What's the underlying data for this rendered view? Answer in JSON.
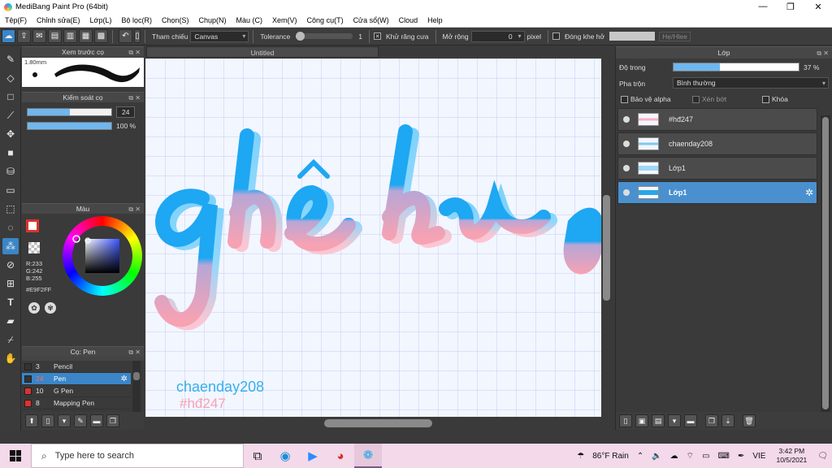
{
  "window": {
    "title": "MediBang Paint Pro (64bit)",
    "controls": [
      "—",
      "❐",
      "✕"
    ]
  },
  "menu": [
    "Tệp(F)",
    "Chỉnh sửa(E)",
    "Lớp(L)",
    "Bộ lọc(R)",
    "Chọn(S)",
    "Chụp(N)",
    "Màu (C)",
    "Xem(V)",
    "Công cụ(T)",
    "Cửa sổ(W)",
    "Cloud",
    "Help"
  ],
  "toolbar": {
    "reference_label": "Tham chiếu",
    "reference_value": "Canvas",
    "tolerance_label": "Tolerance",
    "tolerance_value": "1",
    "antialias_label": "Khử răng cưa",
    "expand_label": "Mở rộng",
    "expand_value": "0",
    "expand_unit": "pixel",
    "close_gap_label": "Đóng khe hở",
    "disabled_label": "Hẹ/Hlee"
  },
  "panels": {
    "brush_preview": {
      "title": "Xem trước cọ",
      "size_label": "1.80mm"
    },
    "brush_control": {
      "title": "Kiểm soát cọ",
      "size_value": "24",
      "size_fraction": 0.5,
      "opacity_value": "100 %",
      "opacity_fraction": 1.0
    },
    "color": {
      "title": "Màu",
      "r": "R:233",
      "g": "G:242",
      "b": "B:255",
      "hex": "#E9F2FF",
      "fg_color": "#e8e8e8",
      "accent": "#d9342b"
    },
    "brush_list": {
      "title": "Cọ: Pen",
      "items": [
        {
          "num": "3",
          "name": "Pencil",
          "color": "#333333"
        },
        {
          "num": "24",
          "name": "Pen",
          "color": "#333333",
          "selected": true
        },
        {
          "num": "10",
          "name": "G Pen",
          "color": "#e03030"
        },
        {
          "num": "8",
          "name": "Mapping Pen",
          "color": "#e03030"
        }
      ]
    }
  },
  "canvas": {
    "tab_title": "Untitled",
    "art_words": [
      "ghê ho",
      "chaenday208",
      "#hđ247"
    ],
    "art_colors": {
      "blue": "#1ea7f2",
      "pink": "#f6a2b3",
      "text_blue": "#36b0ee",
      "text_pink": "#f7a1b6"
    }
  },
  "layers": {
    "title": "Lớp",
    "opacity_label": "Độ trong",
    "opacity_value": "37 %",
    "opacity_fraction": 0.37,
    "blend_label": "Pha trộn",
    "blend_value": "Bình thường",
    "protect_alpha": "Bảo vệ alpha",
    "clipping": "Xén bớt",
    "lock": "Khóa",
    "items": [
      {
        "name": "#hđ247",
        "selected": false
      },
      {
        "name": "chaenday208",
        "selected": false
      },
      {
        "name": "Lớp1",
        "selected": false
      },
      {
        "name": "Lớp1",
        "selected": true
      }
    ]
  },
  "taskbar": {
    "search_placeholder": "Type here to search",
    "weather": "86°F  Rain",
    "lang": "VIE",
    "time": "3:42 PM",
    "date": "10/5/2021"
  }
}
